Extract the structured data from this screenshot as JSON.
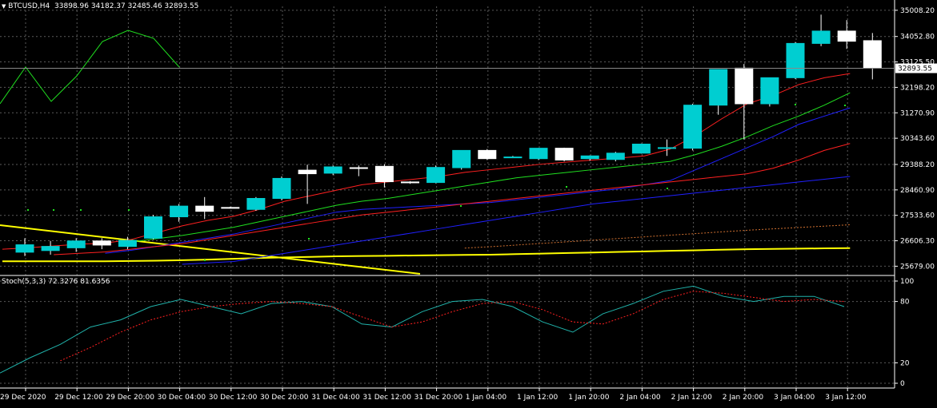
{
  "header": {
    "symbol": "BTCUSD,H4",
    "ohlc": "33898.96 34182.37 32485.46 32893.55"
  },
  "stoch": {
    "label": "Stoch(5,3,3) 72.3276 81.6356",
    "levels": [
      "100",
      "80",
      "20",
      "0"
    ]
  },
  "price_axis": {
    "ticks": [
      "35008.20",
      "34052.80",
      "33125.50",
      "32198.20",
      "31270.90",
      "30343.60",
      "29388.20",
      "28460.90",
      "27533.60",
      "26606.30",
      "25679.00"
    ],
    "current_price": "32893.55"
  },
  "time_axis": {
    "ticks": [
      "29 Dec 2020",
      "29 Dec 12:00",
      "29 Dec 20:00",
      "30 Dec 04:00",
      "30 Dec 12:00",
      "30 Dec 20:00",
      "31 Dec 04:00",
      "31 Dec 12:00",
      "31 Dec 20:00",
      "1 Jan 04:00",
      "1 Jan 12:00",
      "1 Jan 20:00",
      "2 Jan 04:00",
      "2 Jan 12:00",
      "2 Jan 20:00",
      "3 Jan 04:00",
      "3 Jan 12:00"
    ]
  },
  "colors": {
    "background": "#000000",
    "grid": "#5a5a5a",
    "bull_candle": "#00ced1",
    "bear_candle": "#ffffff",
    "ma_yellow": "#ffff00",
    "ma_red": "#ff2020",
    "ma_green": "#20e020",
    "ma_blue": "#2020ff",
    "stoch_main": "#20b2aa",
    "stoch_signal": "#ff2020"
  },
  "chart_data": {
    "type": "candlestick",
    "candles": [
      {
        "o": 26190,
        "h": 26700,
        "l": 26050,
        "c": 26460
      },
      {
        "o": 26250,
        "h": 26600,
        "l": 26100,
        "c": 26400
      },
      {
        "o": 26350,
        "h": 26700,
        "l": 26200,
        "c": 26600
      },
      {
        "o": 26600,
        "h": 26700,
        "l": 26300,
        "c": 26450
      },
      {
        "o": 26400,
        "h": 26750,
        "l": 26300,
        "c": 26620
      },
      {
        "o": 26700,
        "h": 27550,
        "l": 26650,
        "c": 27480
      },
      {
        "o": 27480,
        "h": 27950,
        "l": 27300,
        "c": 27870
      },
      {
        "o": 27870,
        "h": 28200,
        "l": 27400,
        "c": 27680
      },
      {
        "o": 27820,
        "h": 27850,
        "l": 27780,
        "c": 27800
      },
      {
        "o": 27750,
        "h": 28200,
        "l": 27700,
        "c": 28150
      },
      {
        "o": 28150,
        "h": 28950,
        "l": 28080,
        "c": 28880
      },
      {
        "o": 29180,
        "h": 29380,
        "l": 27950,
        "c": 29050
      },
      {
        "o": 29070,
        "h": 29350,
        "l": 29000,
        "c": 29300
      },
      {
        "o": 29270,
        "h": 29350,
        "l": 28960,
        "c": 29250
      },
      {
        "o": 29320,
        "h": 29400,
        "l": 28550,
        "c": 28760
      },
      {
        "o": 28750,
        "h": 28780,
        "l": 28680,
        "c": 28720
      },
      {
        "o": 28730,
        "h": 29350,
        "l": 28700,
        "c": 29280
      },
      {
        "o": 29270,
        "h": 29900,
        "l": 29200,
        "c": 29900
      },
      {
        "o": 29900,
        "h": 29950,
        "l": 29550,
        "c": 29600
      },
      {
        "o": 29660,
        "h": 29700,
        "l": 29640,
        "c": 29660
      },
      {
        "o": 29600,
        "h": 29990,
        "l": 29550,
        "c": 29980
      },
      {
        "o": 29980,
        "h": 30000,
        "l": 29500,
        "c": 29550
      },
      {
        "o": 29600,
        "h": 29720,
        "l": 29520,
        "c": 29700
      },
      {
        "o": 29570,
        "h": 29850,
        "l": 29500,
        "c": 29800
      },
      {
        "o": 29800,
        "h": 30150,
        "l": 29780,
        "c": 30130
      },
      {
        "o": 30000,
        "h": 30300,
        "l": 29700,
        "c": 30000
      },
      {
        "o": 29980,
        "h": 31600,
        "l": 29900,
        "c": 31550
      },
      {
        "o": 31550,
        "h": 32850,
        "l": 31200,
        "c": 32850
      },
      {
        "o": 32900,
        "h": 33050,
        "l": 30300,
        "c": 31600
      },
      {
        "o": 31600,
        "h": 32550,
        "l": 31500,
        "c": 32550
      },
      {
        "o": 32550,
        "h": 33850,
        "l": 32500,
        "c": 33800
      },
      {
        "o": 33800,
        "h": 34850,
        "l": 33700,
        "c": 34250
      },
      {
        "o": 34250,
        "h": 34650,
        "l": 33600,
        "c": 33880
      },
      {
        "o": 33900,
        "h": 34180,
        "l": 32490,
        "c": 32895
      }
    ],
    "ma_red_fast": [
      26300,
      26350,
      26420,
      26480,
      26520,
      26650,
      26900,
      27150,
      27350,
      27500,
      27750,
      28050,
      28250,
      28450,
      28650,
      28750,
      28850,
      28950,
      29100,
      29200,
      29300,
      29400,
      29480,
      29550,
      29620,
      29700,
      29950,
      30450,
      31050,
      31600,
      31900,
      32300,
      32550,
      32700
    ],
    "ma_green": [
      null,
      null,
      null,
      null,
      null,
      26560,
      26680,
      26800,
      26950,
      27100,
      27300,
      27500,
      27700,
      27900,
      28050,
      28150,
      28300,
      28450,
      28600,
      28750,
      28900,
      29000,
      29100,
      29200,
      29300,
      29400,
      29500,
      29750,
      30050,
      30400,
      30800,
      31150,
      31550,
      32000
    ],
    "ma_blue_fast": [
      null,
      null,
      null,
      null,
      26150,
      26260,
      26400,
      26550,
      26700,
      26850,
      27050,
      27250,
      27450,
      27650,
      27750,
      27800,
      27850,
      27900,
      27950,
      28000,
      28100,
      28200,
      28300,
      28400,
      28500,
      28650,
      28800,
      29200,
      29600,
      30000,
      30400,
      30850,
      31150,
      31450
    ],
    "ma_red_slow": [
      null,
      null,
      26100,
      26150,
      26200,
      26300,
      26400,
      26500,
      26650,
      26800,
      26950,
      27100,
      27250,
      27400,
      27550,
      27650,
      27750,
      27850,
      27950,
      28050,
      28150,
      28250,
      28350,
      28450,
      28550,
      28650,
      28750,
      28850,
      28950,
      29050,
      29250,
      29550,
      29900,
      30150
    ],
    "ma_blue_slow": [
      null,
      null,
      null,
      null,
      null,
      null,
      null,
      25750,
      25800,
      25850,
      26000,
      26150,
      26300,
      26450,
      26600,
      26750,
      26900,
      27050,
      27200,
      27350,
      27500,
      27650,
      27800,
      27950,
      28050,
      28150,
      28250,
      28350,
      28450,
      28550,
      28650,
      28750,
      28850,
      28950
    ],
    "ma_yellow_slow": [
      25860,
      25860,
      25860,
      25860,
      25860,
      25870,
      25880,
      25900,
      25920,
      25950,
      25980,
      26000,
      26020,
      26040,
      26050,
      26060,
      26070,
      26080,
      26090,
      26100,
      26120,
      26140,
      26160,
      26180,
      26200,
      26220,
      26240,
      26260,
      26280,
      26300,
      26310,
      26320,
      26330,
      26340
    ],
    "stoch_main": [
      10,
      25,
      38,
      55,
      62,
      75,
      82,
      75,
      68,
      78,
      80,
      75,
      58,
      55,
      70,
      80,
      82,
      75,
      60,
      50,
      68,
      78,
      90,
      95,
      85,
      80,
      85,
      85,
      75
    ],
    "stoch_signal": [
      null,
      null,
      22,
      35,
      50,
      62,
      70,
      75,
      78,
      80,
      78,
      75,
      65,
      55,
      60,
      70,
      78,
      80,
      72,
      60,
      58,
      68,
      82,
      90,
      88,
      84,
      80,
      82,
      80
    ],
    "price_range": [
      25400,
      35150
    ],
    "stoch_range": [
      0,
      100
    ]
  }
}
